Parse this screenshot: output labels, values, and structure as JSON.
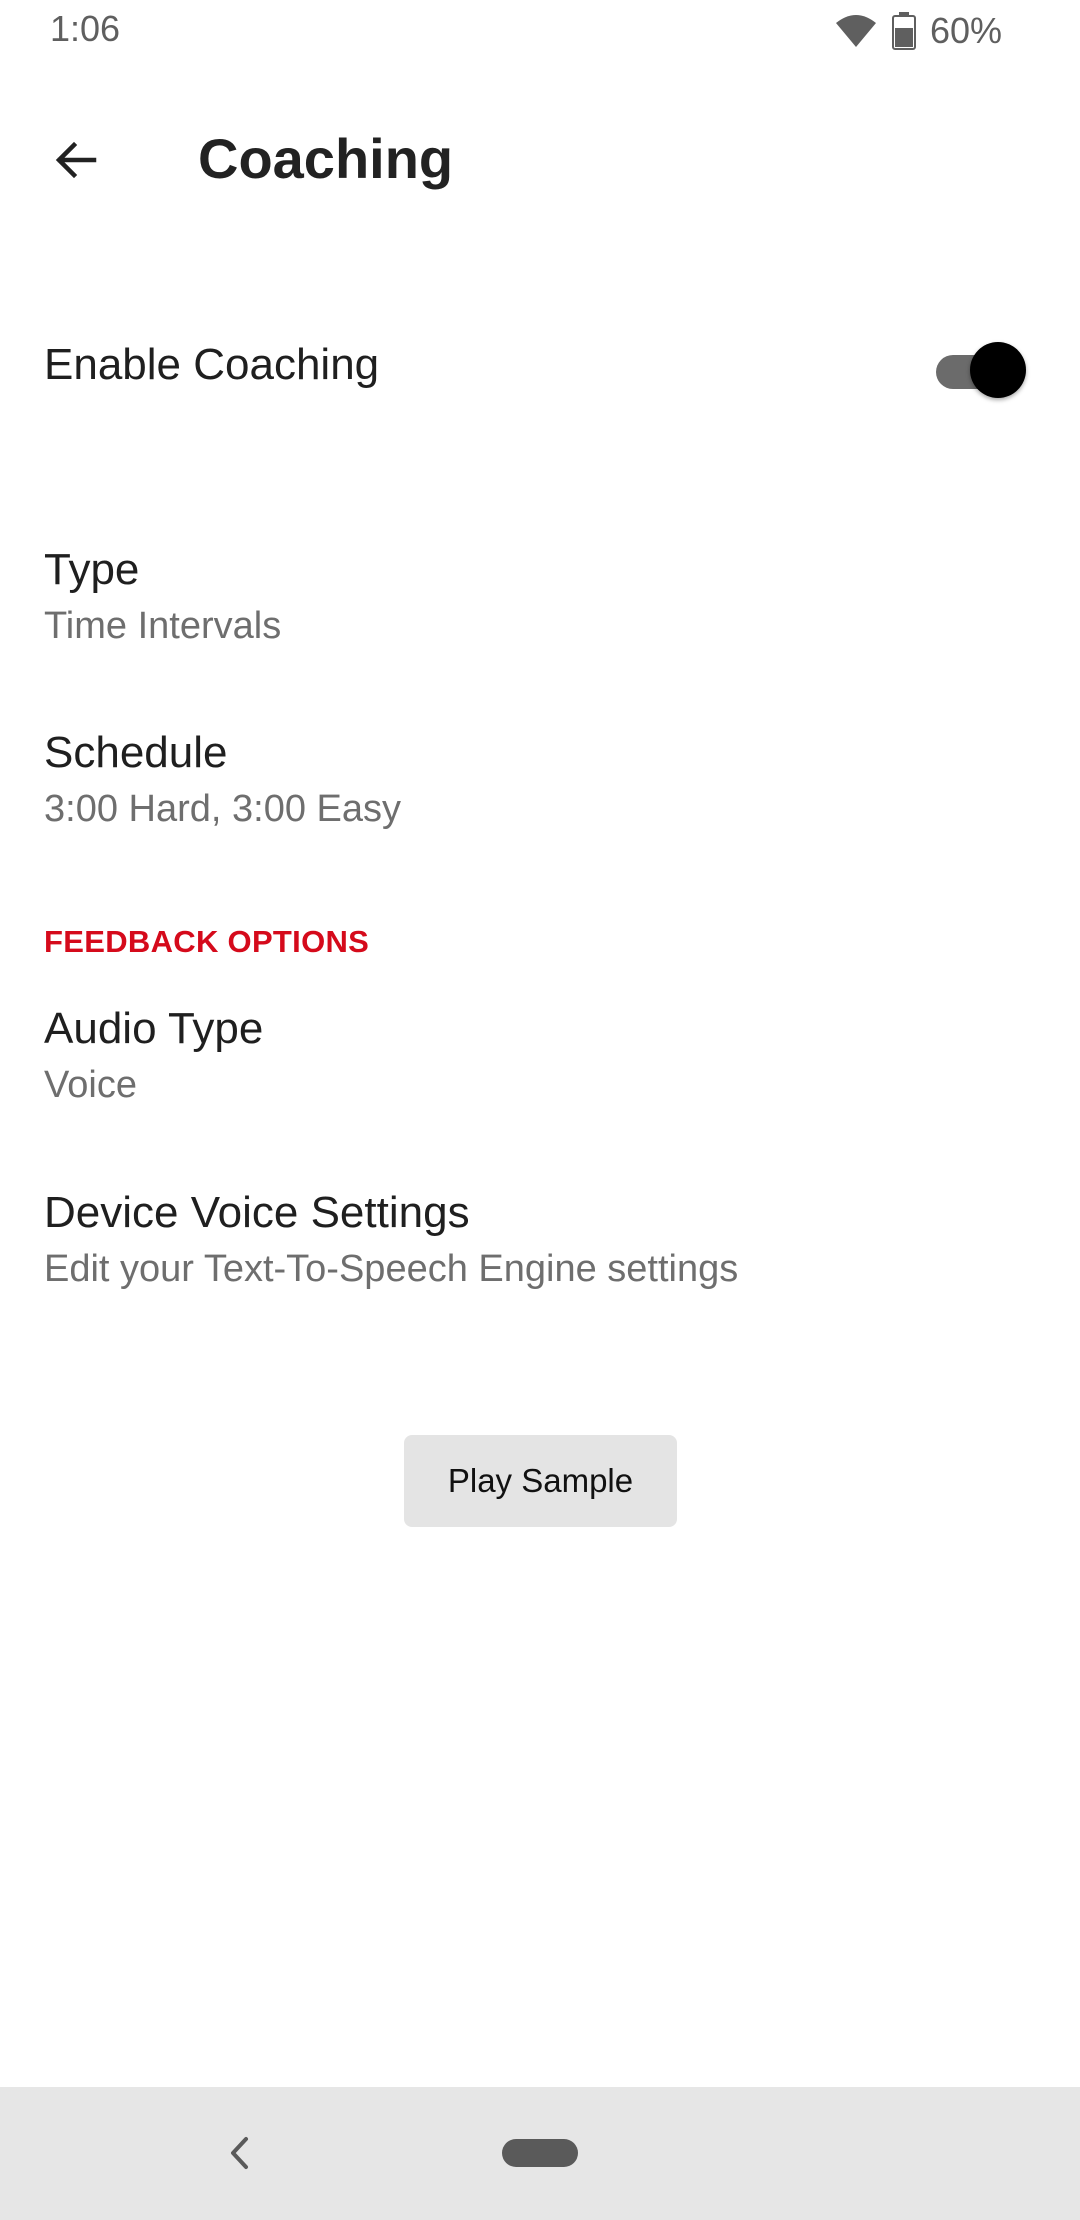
{
  "status_bar": {
    "time": "1:06",
    "battery_percent": "60%",
    "icons": [
      "wifi-icon",
      "battery-icon"
    ]
  },
  "app_bar": {
    "back_icon": "arrow-left-icon",
    "title": "Coaching"
  },
  "enable_coaching": {
    "label": "Enable Coaching",
    "enabled": true
  },
  "settings": [
    {
      "title": "Type",
      "value": "Time Intervals"
    },
    {
      "title": "Schedule",
      "value": "3:00 Hard, 3:00 Easy"
    }
  ],
  "feedback_section": {
    "header": "FEEDBACK OPTIONS",
    "items": [
      {
        "title": "Audio Type",
        "value": "Voice"
      },
      {
        "title": "Device Voice Settings",
        "value": "Edit your Text-To-Speech Engine settings"
      }
    ]
  },
  "play_sample_button": {
    "label": "Play Sample"
  },
  "nav_bar": {
    "back_icon": "chevron-left-icon",
    "home_icon": "home-pill-icon"
  },
  "colors": {
    "accent_red": "#d50a1b",
    "switch_thumb": "#000000",
    "switch_track": "#6b6b6b",
    "button_bg": "#e4e4e4",
    "nav_bg": "#e6e6e6"
  }
}
